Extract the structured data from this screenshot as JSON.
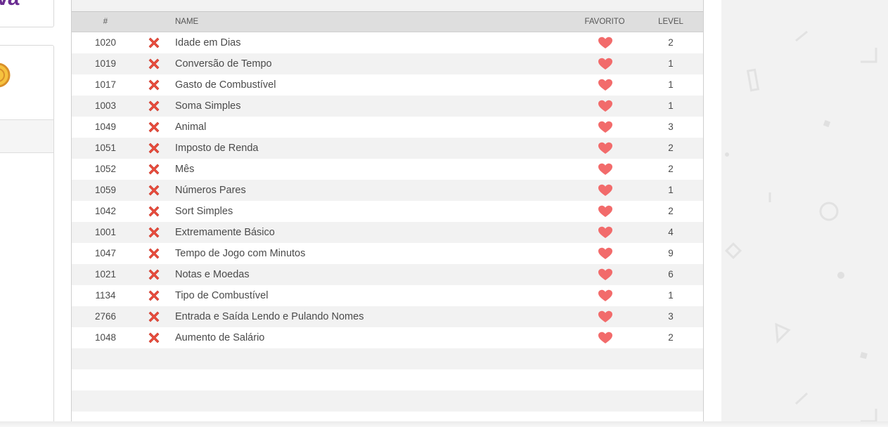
{
  "sidebar": {
    "logo_fragment": "va"
  },
  "table": {
    "headers": {
      "num": "#",
      "name": "NAME",
      "favorite": "FAVORITO",
      "level": "LEVEL"
    },
    "rows": [
      {
        "id": "1020",
        "name": "Idade em Dias",
        "level": "2"
      },
      {
        "id": "1019",
        "name": "Conversão de Tempo",
        "level": "1"
      },
      {
        "id": "1017",
        "name": "Gasto de Combustível",
        "level": "1"
      },
      {
        "id": "1003",
        "name": "Soma Simples",
        "level": "1"
      },
      {
        "id": "1049",
        "name": "Animal",
        "level": "3"
      },
      {
        "id": "1051",
        "name": "Imposto de Renda",
        "level": "2"
      },
      {
        "id": "1052",
        "name": "Mês",
        "level": "2"
      },
      {
        "id": "1059",
        "name": "Números Pares",
        "level": "1"
      },
      {
        "id": "1042",
        "name": "Sort Simples",
        "level": "2"
      },
      {
        "id": "1001",
        "name": "Extremamente Básico",
        "level": "4"
      },
      {
        "id": "1047",
        "name": "Tempo de Jogo com Minutos",
        "level": "9"
      },
      {
        "id": "1021",
        "name": "Notas e Moedas",
        "level": "6"
      },
      {
        "id": "1134",
        "name": "Tipo de Combustível",
        "level": "1"
      },
      {
        "id": "2766",
        "name": "Entrada e Saída Lendo e Pulando Nomes",
        "level": "3"
      },
      {
        "id": "1048",
        "name": "Aumento de Salário",
        "level": "2"
      }
    ],
    "empty_rows": 4
  },
  "icons": {
    "status": "remove-x-icon",
    "favorite": "heart-icon"
  },
  "colors": {
    "x_red": "#e84c3d",
    "heart": "#f26b6b",
    "brand_purple": "#6a2c91",
    "header_bg": "#dedede"
  }
}
